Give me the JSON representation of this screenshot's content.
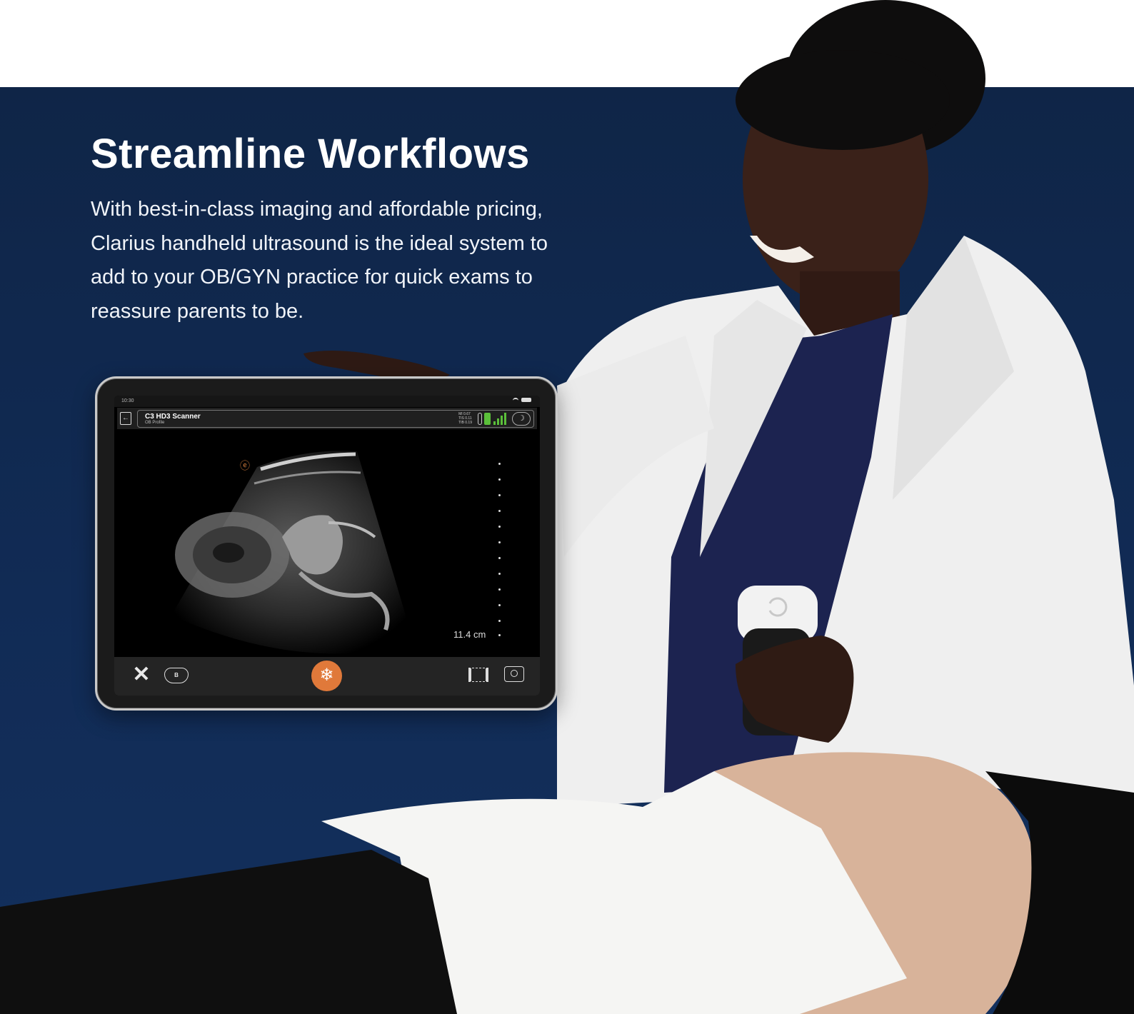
{
  "hero": {
    "title": "Streamline Workflows",
    "description": "With best-in-class imaging and affordable pricing, Clarius handheld ultrasound is the ideal system to add to your OB/GYN practice for quick exams to reassure parents to be."
  },
  "tablet": {
    "status_time": "10:30",
    "scanner_name": "C3 HD3 Scanner",
    "scanner_profile": "OB Profile",
    "acoustic": [
      "MI 0.67",
      "TIS 0.11",
      "TIB 0.19"
    ],
    "depth_label": "11.4 cm",
    "bmode_label": "B",
    "icons": [
      "back-icon",
      "thermometer-icon",
      "battery-icon",
      "signal-icon",
      "sleep-icon",
      "close-tools-icon",
      "b-mode-icon",
      "freeze-icon",
      "cine-icon",
      "camera-icon"
    ]
  },
  "colors": {
    "hero_bg": "#112b55",
    "freeze_accent": "#e0793a",
    "battery_green": "#5bbf3a"
  }
}
